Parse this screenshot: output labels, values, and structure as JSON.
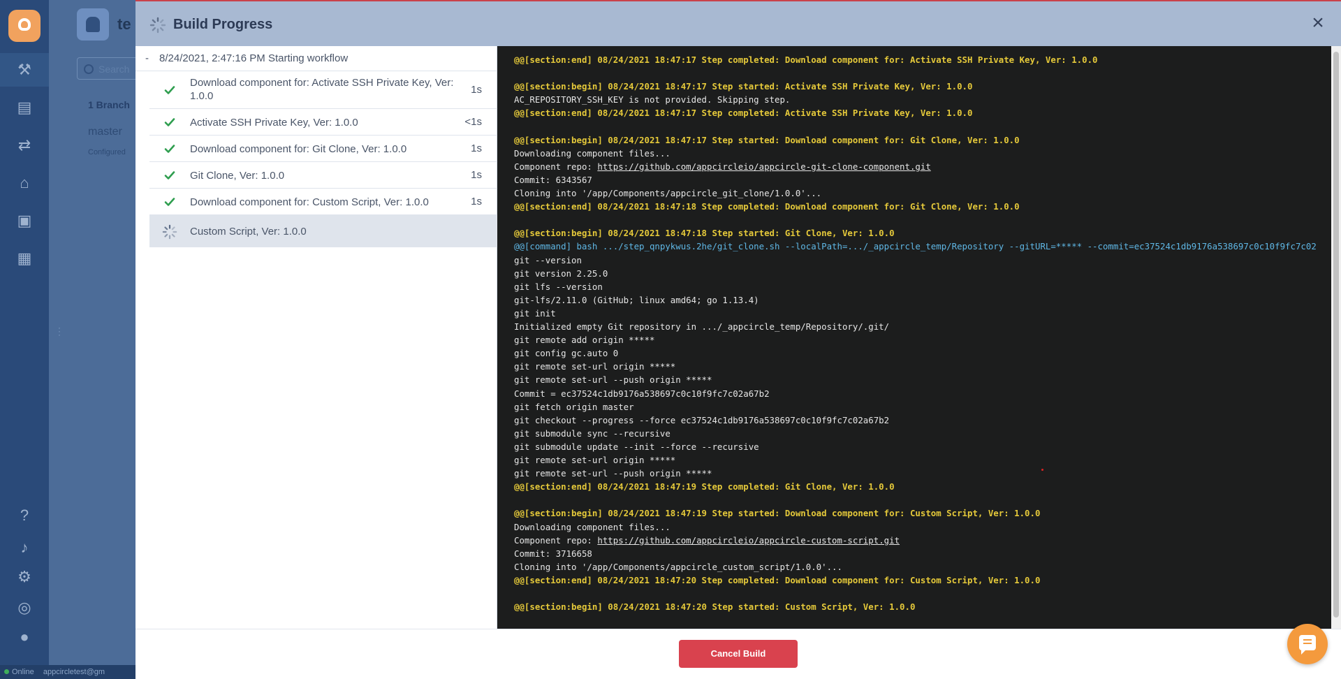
{
  "background": {
    "app_title": "te",
    "search_placeholder": "Search",
    "branch_count": "1 Branch",
    "branch_name": "master",
    "branch_status": "Configured",
    "status_text": "Online",
    "user_email": "appcircletest@gm"
  },
  "modal": {
    "title": "Build Progress",
    "workflow_start": "8/24/2021, 2:47:16 PM Starting workflow",
    "cancel_label": "Cancel Build",
    "steps": [
      {
        "label": "Download component for: Activate SSH Private Key, Ver: 1.0.0",
        "duration": "1s",
        "status": "done"
      },
      {
        "label": "Activate SSH Private Key, Ver: 1.0.0",
        "duration": "<1s",
        "status": "done"
      },
      {
        "label": "Download component for: Git Clone, Ver: 1.0.0",
        "duration": "1s",
        "status": "done"
      },
      {
        "label": "Git Clone, Ver: 1.0.0",
        "duration": "1s",
        "status": "done"
      },
      {
        "label": "Download component for: Custom Script, Ver: 1.0.0",
        "duration": "1s",
        "status": "done"
      },
      {
        "label": "Custom Script, Ver: 1.0.0",
        "duration": "",
        "status": "running"
      }
    ]
  },
  "log": {
    "lines": [
      {
        "text": "@@[section:end] 08/24/2021 18:47:17 Step completed: Download component for: Activate SSH Private Key, Ver: 1.0.0",
        "kind": "sec"
      },
      {
        "text": "",
        "kind": "plain"
      },
      {
        "text": "@@[section:begin] 08/24/2021 18:47:17 Step started: Activate SSH Private Key, Ver: 1.0.0",
        "kind": "sec"
      },
      {
        "text": "AC_REPOSITORY_SSH_KEY is not provided. Skipping step.",
        "kind": "plain"
      },
      {
        "text": "@@[section:end] 08/24/2021 18:47:17 Step completed: Activate SSH Private Key, Ver: 1.0.0",
        "kind": "sec"
      },
      {
        "text": "",
        "kind": "plain"
      },
      {
        "text": "@@[section:begin] 08/24/2021 18:47:17 Step started: Download component for: Git Clone, Ver: 1.0.0",
        "kind": "sec"
      },
      {
        "text": "Downloading component files...",
        "kind": "plain"
      },
      {
        "text": "Component repo: ",
        "link": "https://github.com/appcircleio/appcircle-git-clone-component.git",
        "kind": "plain"
      },
      {
        "text": "Commit: 6343567",
        "kind": "plain"
      },
      {
        "text": "Cloning into '/app/Components/appcircle_git_clone/1.0.0'...",
        "kind": "plain"
      },
      {
        "text": "@@[section:end] 08/24/2021 18:47:18 Step completed: Download component for: Git Clone, Ver: 1.0.0",
        "kind": "sec"
      },
      {
        "text": "",
        "kind": "plain"
      },
      {
        "text": "@@[section:begin] 08/24/2021 18:47:18 Step started: Git Clone, Ver: 1.0.0",
        "kind": "sec"
      },
      {
        "text": "@@[command] bash .../step_qnpykwus.2he/git_clone.sh --localPath=.../_appcircle_temp/Repository --gitURL=***** --commit=ec37524c1db9176a538697c0c10f9fc7c02",
        "kind": "cmd"
      },
      {
        "text": "git --version",
        "kind": "plain"
      },
      {
        "text": "git version 2.25.0",
        "kind": "plain"
      },
      {
        "text": "git lfs --version",
        "kind": "plain"
      },
      {
        "text": "git-lfs/2.11.0 (GitHub; linux amd64; go 1.13.4)",
        "kind": "plain"
      },
      {
        "text": "git init",
        "kind": "plain"
      },
      {
        "text": "Initialized empty Git repository in .../_appcircle_temp/Repository/.git/",
        "kind": "plain"
      },
      {
        "text": "git remote add origin *****",
        "kind": "plain"
      },
      {
        "text": "git config gc.auto 0",
        "kind": "plain"
      },
      {
        "text": "git remote set-url origin *****",
        "kind": "plain"
      },
      {
        "text": "git remote set-url --push origin *****",
        "kind": "plain"
      },
      {
        "text": "Commit = ec37524c1db9176a538697c0c10f9fc7c02a67b2",
        "kind": "plain"
      },
      {
        "text": "git fetch origin master",
        "kind": "plain"
      },
      {
        "text": "git checkout --progress --force ec37524c1db9176a538697c0c10f9fc7c02a67b2",
        "kind": "plain"
      },
      {
        "text": "git submodule sync --recursive",
        "kind": "plain"
      },
      {
        "text": "git submodule update --init --force --recursive",
        "kind": "plain"
      },
      {
        "text": "git remote set-url origin *****",
        "kind": "plain"
      },
      {
        "text": "git remote set-url --push origin *****",
        "kind": "plain"
      },
      {
        "text": "@@[section:end] 08/24/2021 18:47:19 Step completed: Git Clone, Ver: 1.0.0",
        "kind": "sec"
      },
      {
        "text": "",
        "kind": "plain"
      },
      {
        "text": "@@[section:begin] 08/24/2021 18:47:19 Step started: Download component for: Custom Script, Ver: 1.0.0",
        "kind": "sec"
      },
      {
        "text": "Downloading component files...",
        "kind": "plain"
      },
      {
        "text": "Component repo: ",
        "link": "https://github.com/appcircleio/appcircle-custom-script.git",
        "kind": "plain"
      },
      {
        "text": "Commit: 3716658",
        "kind": "plain"
      },
      {
        "text": "Cloning into '/app/Components/appcircle_custom_script/1.0.0'...",
        "kind": "plain"
      },
      {
        "text": "@@[section:end] 08/24/2021 18:47:20 Step completed: Download component for: Custom Script, Ver: 1.0.0",
        "kind": "sec"
      },
      {
        "text": "",
        "kind": "plain"
      },
      {
        "text": "@@[section:begin] 08/24/2021 18:47:20 Step started: Custom Script, Ver: 1.0.0",
        "kind": "sec"
      }
    ]
  },
  "colors": {
    "accent_red": "#d9424e",
    "success_green": "#2f9e4f",
    "log_section": "#e5c93a",
    "log_command": "#5fb7e5",
    "chat_orange": "#f49a3d"
  }
}
